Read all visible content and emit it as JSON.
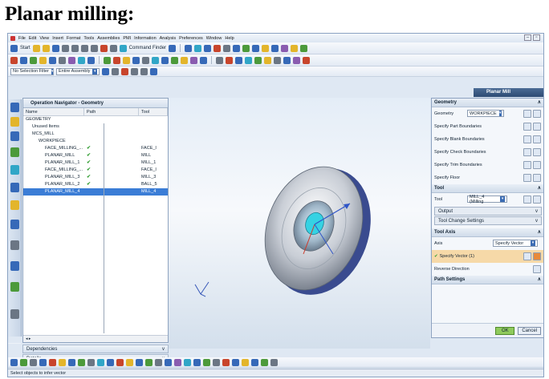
{
  "caption": "Planar milling:",
  "menu": [
    "File",
    "Edit",
    "View",
    "Insert",
    "Format",
    "Tools",
    "Assemblies",
    "PMI",
    "Information",
    "Analysis",
    "Preferences",
    "Window",
    "Help"
  ],
  "toolbar": {
    "start_label": "Start",
    "command_finder_label": "Command Finder",
    "selection_filter": "No Selection Filter",
    "assembly_scope": "Entire Assembly"
  },
  "navigator": {
    "title": "Operation Navigator - Geometry",
    "columns": [
      "Name",
      "Path",
      "Tool"
    ],
    "rows": [
      {
        "name": "GEOMETRY",
        "path": "",
        "tool": "",
        "check": false,
        "selected": false,
        "indent": 0
      },
      {
        "name": "Unused Items",
        "path": "",
        "tool": "",
        "check": false,
        "selected": false,
        "indent": 1
      },
      {
        "name": "MCS_MILL",
        "path": "",
        "tool": "",
        "check": false,
        "selected": false,
        "indent": 1
      },
      {
        "name": "WORKPIECE",
        "path": "",
        "tool": "",
        "check": false,
        "selected": false,
        "indent": 2
      },
      {
        "name": "FACE_MILLING_...",
        "path": "✔",
        "tool": "FACE_I",
        "check": true,
        "selected": false,
        "indent": 3
      },
      {
        "name": "PLANAR_MILL",
        "path": "✔",
        "tool": "MILL",
        "check": true,
        "selected": false,
        "indent": 3
      },
      {
        "name": "PLANAR_MILL_1",
        "path": "✔",
        "tool": "MILL_1",
        "check": true,
        "selected": false,
        "indent": 3
      },
      {
        "name": "FACE_MILLING_...",
        "path": "✔",
        "tool": "FACE_I",
        "check": true,
        "selected": false,
        "indent": 3
      },
      {
        "name": "PLANAR_MILL_3",
        "path": "✔",
        "tool": "MILL_3",
        "check": true,
        "selected": false,
        "indent": 3
      },
      {
        "name": "PLANAR_MILL_2",
        "path": "✔",
        "tool": "BALL_5",
        "check": true,
        "selected": false,
        "indent": 3
      },
      {
        "name": "PLANAR_MILL_4",
        "path": "",
        "tool": "MILL_4",
        "check": false,
        "selected": true,
        "indent": 3
      }
    ],
    "dependencies_label": "Dependencies",
    "details_label": "Details"
  },
  "dialog": {
    "title": "Planar Mill",
    "geometry_header": "Geometry",
    "geometry_label": "Geometry",
    "geometry_value": "WORKPIECE",
    "specify_items": [
      "Specify Part Boundaries",
      "Specify Blank Boundaries",
      "Specify Check Boundaries",
      "Specify Trim Boundaries",
      "Specify Floor"
    ],
    "tool_header": "Tool",
    "tool_label": "Tool",
    "tool_value": "MILL_4 (Milling",
    "output_label": "Output",
    "tool_change_label": "Tool Change Settings",
    "tool_axis_header": "Tool Axis",
    "axis_label": "Axis",
    "axis_value": "Specify Vector",
    "specify_vector_label": "Specify Vector (1)",
    "reverse_direction_label": "Reverse Direction",
    "path_settings_label": "Path Settings",
    "ok_label": "OK",
    "cancel_label": "Cancel"
  },
  "status": "Select objects to infer vector"
}
